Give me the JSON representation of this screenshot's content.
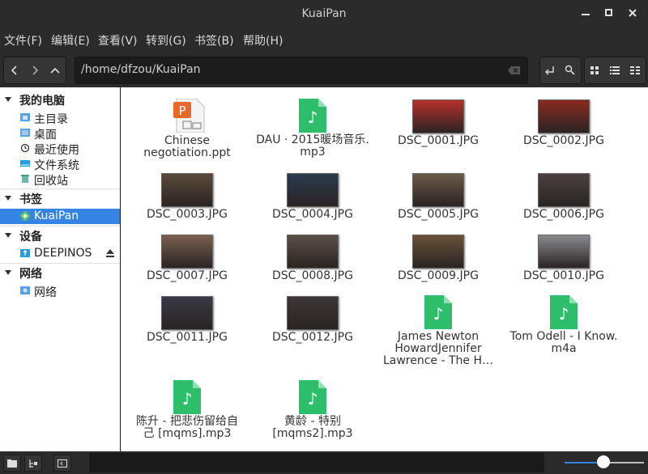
{
  "window": {
    "title": "KuaiPan",
    "minimize_icon": "minimize-icon",
    "maximize_icon": "maximize-icon",
    "close_icon": "close-icon"
  },
  "menu": [
    "文件(F)",
    "编辑(E)",
    "查看(V)",
    "转到(G)",
    "书签(B)",
    "帮助(H)"
  ],
  "toolbar": {
    "path": "/home/dfzou/KuaiPan"
  },
  "sidebar": {
    "sections": [
      {
        "label": "我的电脑",
        "items": [
          "主目录",
          "桌面",
          "最近使用",
          "文件系统",
          "回收站"
        ]
      },
      {
        "label": "书签",
        "items": [
          "KuaiPan"
        ]
      },
      {
        "label": "设备",
        "items": [
          "DEEPINOS"
        ]
      },
      {
        "label": "网络",
        "items": [
          "网络"
        ]
      }
    ],
    "selected": "KuaiPan"
  },
  "files": [
    {
      "name_lines": [
        "Chinese",
        "negotiation.ppt"
      ],
      "type": "ppt"
    },
    {
      "name_lines": [
        "DAU · 2015暖场音乐.",
        "mp3"
      ],
      "type": "audio"
    },
    {
      "name_lines": [
        "DSC_0001.JPG"
      ],
      "type": "image",
      "tone": "#b8302a"
    },
    {
      "name_lines": [
        "DSC_0002.JPG"
      ],
      "type": "image",
      "tone": "#8a2a1e"
    },
    {
      "name_lines": [
        "DSC_0003.JPG"
      ],
      "type": "image",
      "tone": "#5a4a3a"
    },
    {
      "name_lines": [
        "DSC_0004.JPG"
      ],
      "type": "image",
      "tone": "#2a3a4e"
    },
    {
      "name_lines": [
        "DSC_0005.JPG"
      ],
      "type": "image",
      "tone": "#6a5a48"
    },
    {
      "name_lines": [
        "DSC_0006.JPG"
      ],
      "type": "image",
      "tone": "#4a4040"
    },
    {
      "name_lines": [
        "DSC_0007.JPG"
      ],
      "type": "image",
      "tone": "#7a6050"
    },
    {
      "name_lines": [
        "DSC_0008.JPG"
      ],
      "type": "image",
      "tone": "#5a5048"
    },
    {
      "name_lines": [
        "DSC_0009.JPG"
      ],
      "type": "image",
      "tone": "#6a5238"
    },
    {
      "name_lines": [
        "DSC_0010.JPG"
      ],
      "type": "image",
      "tone": "#8a8a8e"
    },
    {
      "name_lines": [
        "DSC_0011.JPG"
      ],
      "type": "image",
      "tone": "#3a3a44"
    },
    {
      "name_lines": [
        "DSC_0012.JPG"
      ],
      "type": "image",
      "tone": "#3e3636"
    },
    {
      "name_lines": [
        "James Newton",
        "HowardJennifer",
        "Lawrence - The H…"
      ],
      "type": "audio"
    },
    {
      "name_lines": [
        "Tom Odell - I Know.",
        "m4a"
      ],
      "type": "audio"
    },
    {
      "name_lines": [
        "陈升 - 把悲伤留给自",
        "己 [mqms].mp3"
      ],
      "type": "audio"
    },
    {
      "name_lines": [
        "黄龄 - 特别",
        "[mqms2].mp3"
      ],
      "type": "audio"
    }
  ],
  "colors": {
    "accent": "#3584e4",
    "audio_icon": "#2ebd6b",
    "ppt_icon": "#e8692a"
  },
  "zoom_level": 0.5
}
